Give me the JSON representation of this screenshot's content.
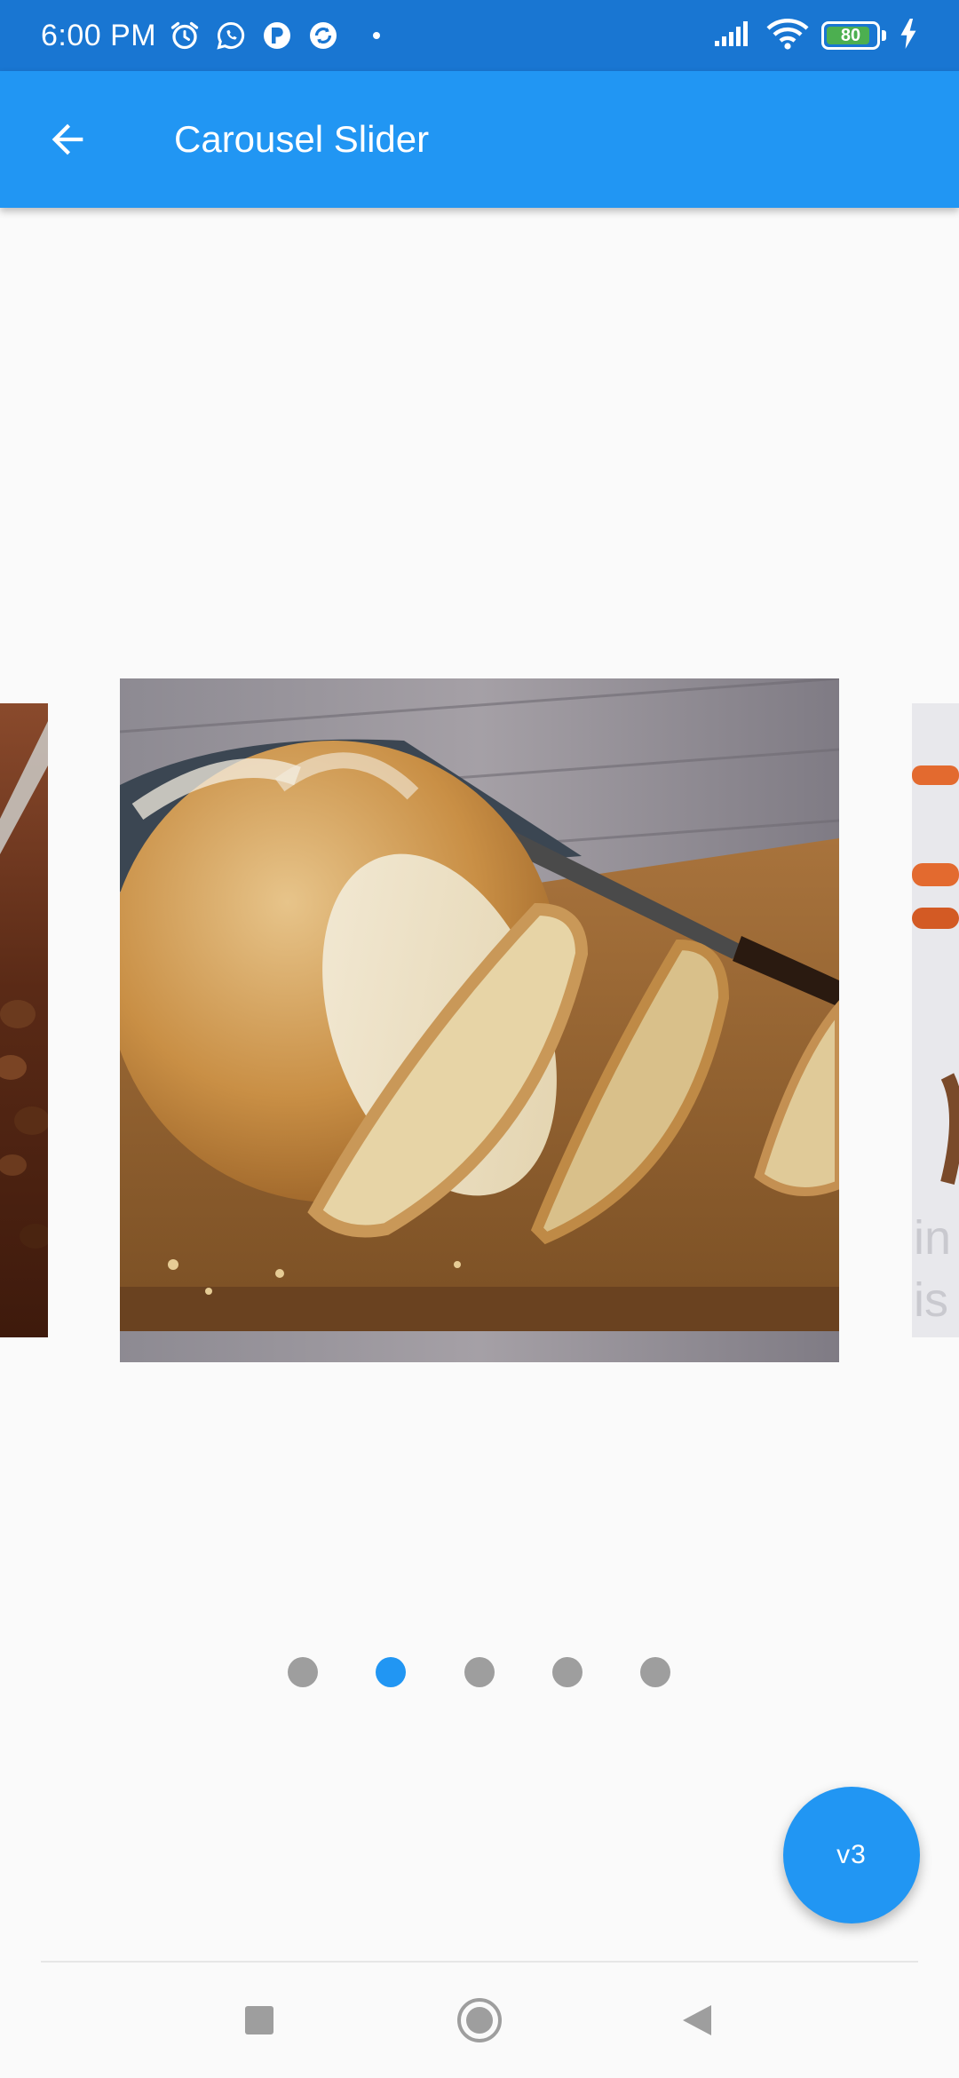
{
  "status_bar": {
    "time": "6:00 PM",
    "battery": "80",
    "icons": [
      "alarm-icon",
      "whatsapp-icon",
      "p-app-icon",
      "sync-app-icon",
      "signal-icon",
      "wifi-icon",
      "battery-icon",
      "charging-icon"
    ]
  },
  "app_bar": {
    "title": "Carousel Slider",
    "back_icon": "arrow-back-icon"
  },
  "carousel": {
    "slides": [
      "coffee-beans-image",
      "bread-loaf-image",
      "carrots-image"
    ],
    "current_index": 1,
    "dot_count": 5
  },
  "fab": {
    "label": "v3"
  },
  "colors": {
    "status_bar": "#1976d2",
    "app_bar": "#2196f3",
    "accent": "#2196f3",
    "dot_inactive": "#9e9e9e",
    "background": "#fafafa"
  },
  "nav_bar": {
    "buttons": [
      "recents-square-icon",
      "home-circle-icon",
      "back-triangle-icon"
    ]
  }
}
